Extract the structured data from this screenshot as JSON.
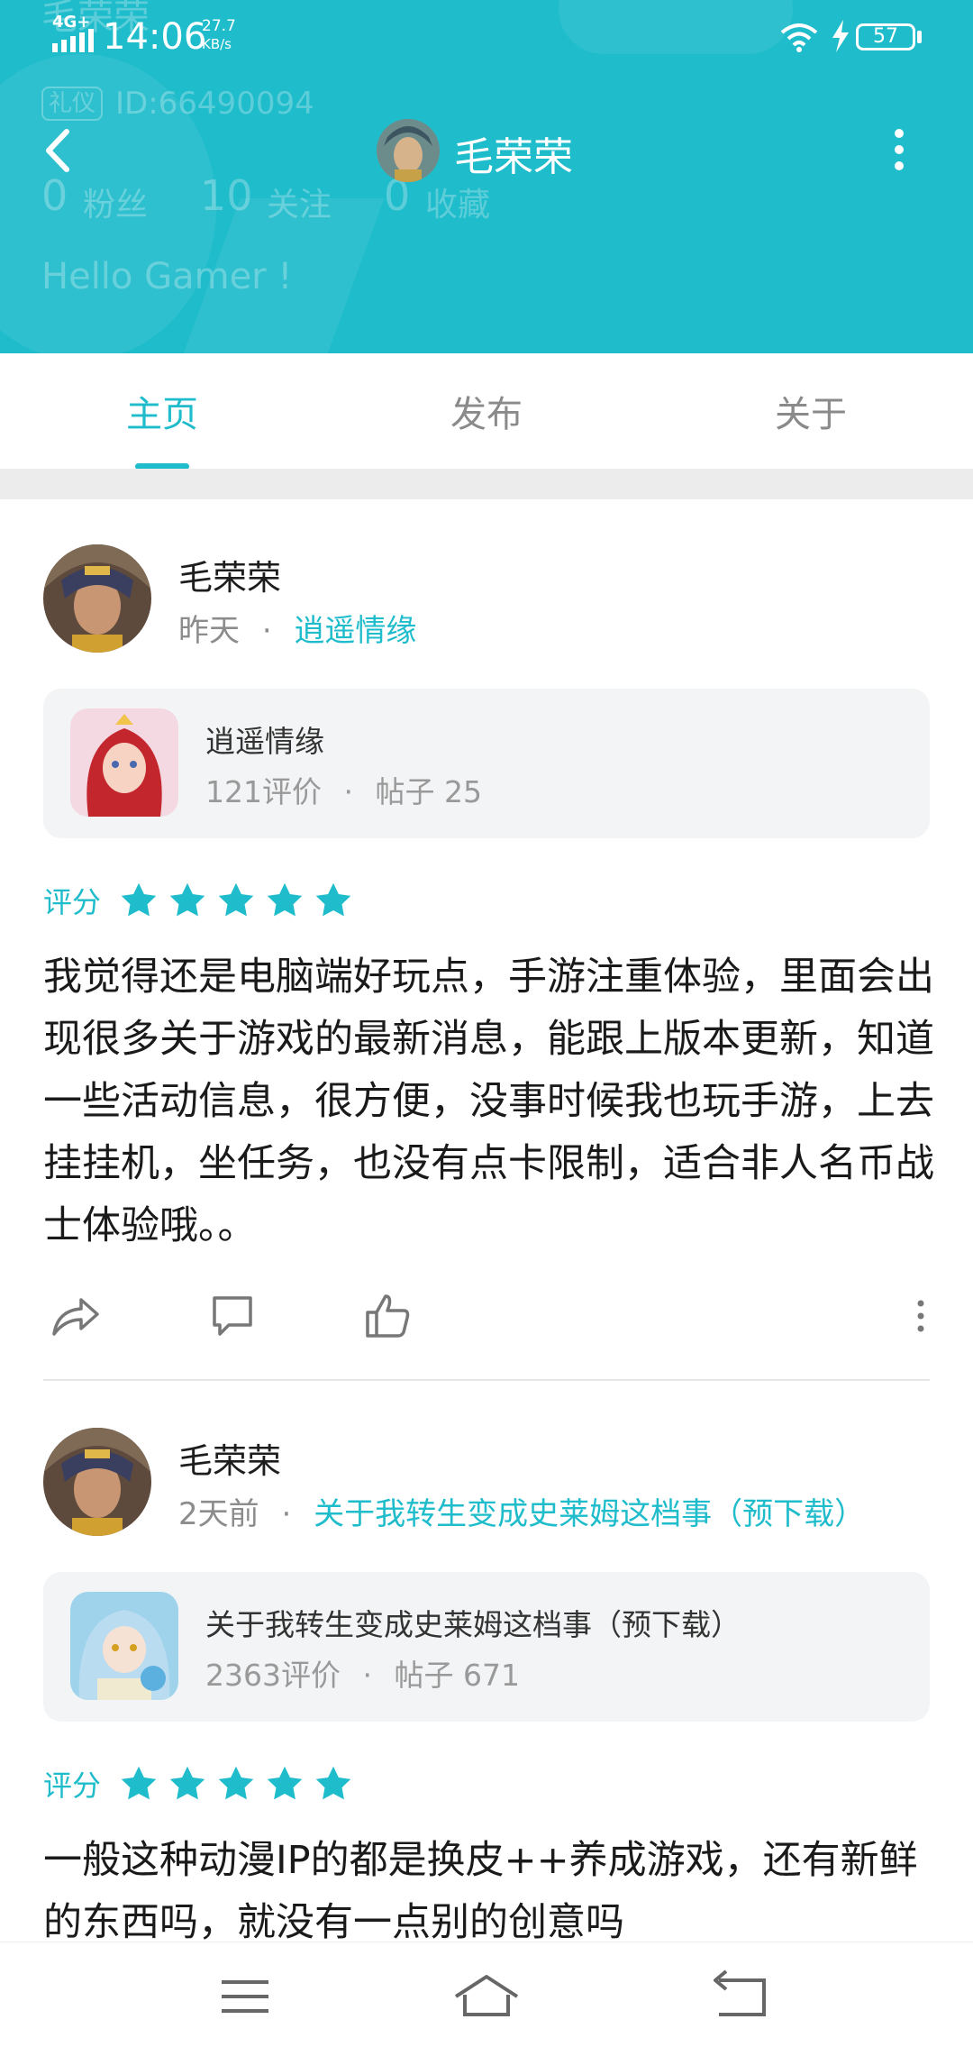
{
  "status_bar": {
    "network": "4G+",
    "time": "14:06",
    "speed_value": "27.7",
    "speed_unit": "KB/s",
    "battery": "57"
  },
  "header": {
    "title": "毛荣荣",
    "ghost_name": "毛荣荣",
    "ghost_badge": "礼仪",
    "ghost_id": "ID:66490094",
    "ghost_fans_num": "0",
    "ghost_fans_label": "粉丝",
    "ghost_follow_num": "10",
    "ghost_follow_label": "关注",
    "ghost_fav_num": "0",
    "ghost_fav_label": "收藏",
    "ghost_greeting": "Hello Gamer !",
    "back_icon": "chevron-left-icon",
    "more_icon": "more-vertical-icon"
  },
  "tabs": [
    {
      "label": "主页",
      "active": true
    },
    {
      "label": "发布",
      "active": false
    },
    {
      "label": "关于",
      "active": false
    }
  ],
  "posts": [
    {
      "author": "毛荣荣",
      "time": "昨天",
      "dot": "·",
      "game_link": "逍遥情缘",
      "game": {
        "title": "逍遥情缘",
        "reviews": "121评价",
        "dot": "·",
        "posts": "帖子 25"
      },
      "rating_label": "评分",
      "stars": 5,
      "text": "我觉得还是电脑端好玩点，手游注重体验，里面会出现很多关于游戏的最新消息，能跟上版本更新，知道一些活动信息，很方便，没事时候我也玩手游，上去挂挂机，坐任务，也没有点卡限制，适合非人名币战士体验哦。。"
    },
    {
      "author": "毛荣荣",
      "time": "2天前",
      "dot": "·",
      "game_link": "关于我转生变成史莱姆这档事（预下载）",
      "game": {
        "title": "关于我转生变成史莱姆这档事（预下载）",
        "reviews": "2363评价",
        "dot": "·",
        "posts": "帖子 671"
      },
      "rating_label": "评分",
      "stars": 5,
      "text": "一般这种动漫IP的都是换皮++养成游戏，还有新鲜的东西吗，就没有一点别的创意吗"
    }
  ],
  "colors": {
    "accent": "#1fbccb",
    "header_bg": "#1fbccb"
  },
  "nav_icons": [
    "menu-icon",
    "home-icon",
    "back-icon"
  ]
}
